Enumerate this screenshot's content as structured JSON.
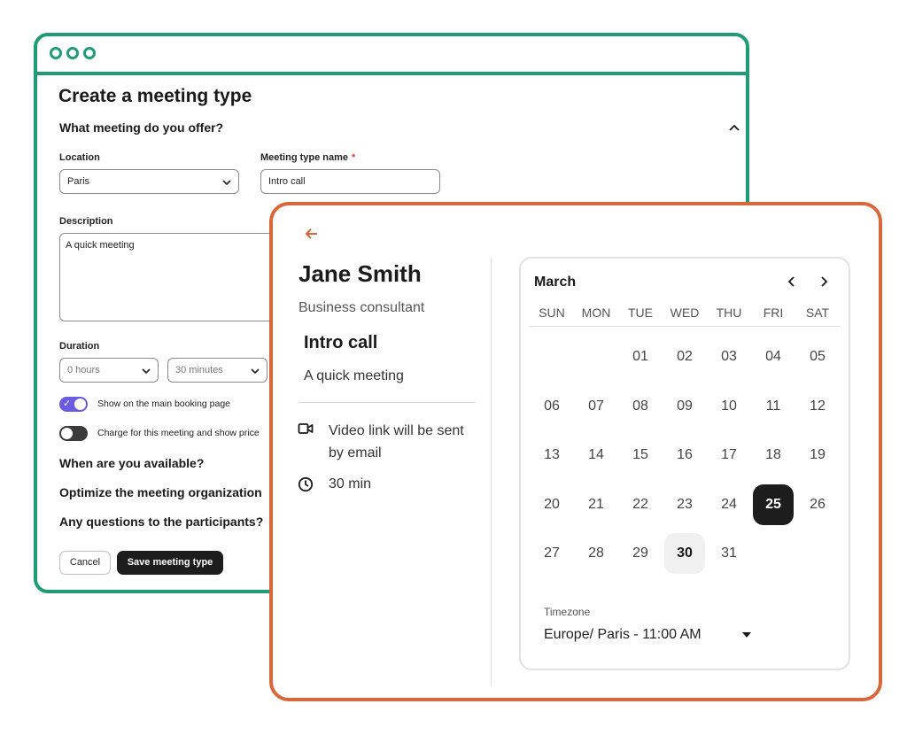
{
  "form_window": {
    "title": "Create a meeting type",
    "section_offer": "What meeting do you offer?",
    "location_label": "Location",
    "location_value": "Paris",
    "meeting_name_label": "Meeting type name",
    "required_mark": "*",
    "meeting_name_value": "Intro call",
    "description_label": "Description",
    "description_value": "A quick meeting",
    "duration_label": "Duration",
    "duration_hours": "0 hours",
    "duration_minutes": "30 minutes",
    "toggle_booking_label": "Show on the main booking page",
    "toggle_booking_on": true,
    "toggle_price_label": "Charge for this meeting and show price",
    "toggle_price_on": false,
    "section_available": "When are you available?",
    "section_optimize": "Optimize the meeting organization",
    "section_questions": "Any questions to the participants?",
    "cancel_label": "Cancel",
    "save_label": "Save meeting type",
    "accent_color": "#1f9c74",
    "toggle_color": "#6a5be0"
  },
  "booking_window": {
    "accent_color": "#d9673a",
    "host_name": "Jane Smith",
    "host_role": "Business consultant",
    "meeting_title": "Intro call",
    "meeting_desc": "A quick meeting",
    "video_info": "Video link will be sent by email",
    "duration": "30 min",
    "icons": [
      "arrow-left-icon",
      "video-camera-icon",
      "clock-icon",
      "chevron-left-icon",
      "chevron-right-icon",
      "caret-down-icon"
    ]
  },
  "calendar": {
    "month": "March",
    "weekdays": [
      "SUN",
      "MON",
      "TUE",
      "WED",
      "THU",
      "FRI",
      "SAT"
    ],
    "weeks": [
      [
        "",
        "",
        "01",
        "02",
        "03",
        "04",
        "05"
      ],
      [
        "06",
        "07",
        "08",
        "09",
        "10",
        "11",
        "12"
      ],
      [
        "13",
        "14",
        "15",
        "16",
        "17",
        "18",
        "19"
      ],
      [
        "20",
        "21",
        "22",
        "23",
        "24",
        "25",
        "26"
      ],
      [
        "27",
        "28",
        "29",
        "30",
        "31",
        "",
        ""
      ]
    ],
    "selected_day": "25",
    "highlighted_day": "30",
    "timezone_label": "Timezone",
    "timezone_value": "Europe/ Paris - 11:00 AM"
  }
}
